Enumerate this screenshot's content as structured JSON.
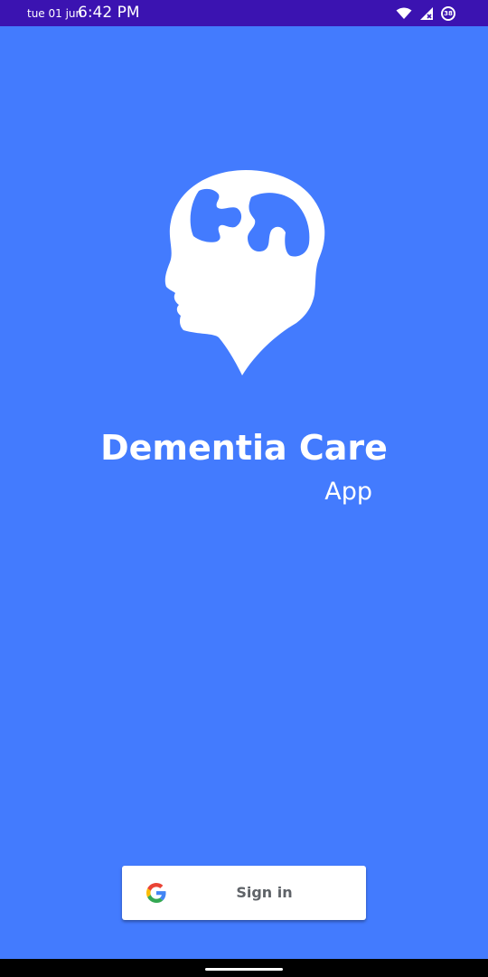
{
  "status_bar": {
    "date": "tue 01 jun",
    "time": "6:42 PM",
    "battery_level": "38"
  },
  "app": {
    "title": "Dementia Care",
    "subtitle": "App"
  },
  "sign_in": {
    "label": "Sign in",
    "icon": "google-icon"
  },
  "colors": {
    "background": "#437bfe",
    "status_bar": "#3b13b1",
    "button_background": "#ffffff",
    "button_text": "#5f6368"
  }
}
